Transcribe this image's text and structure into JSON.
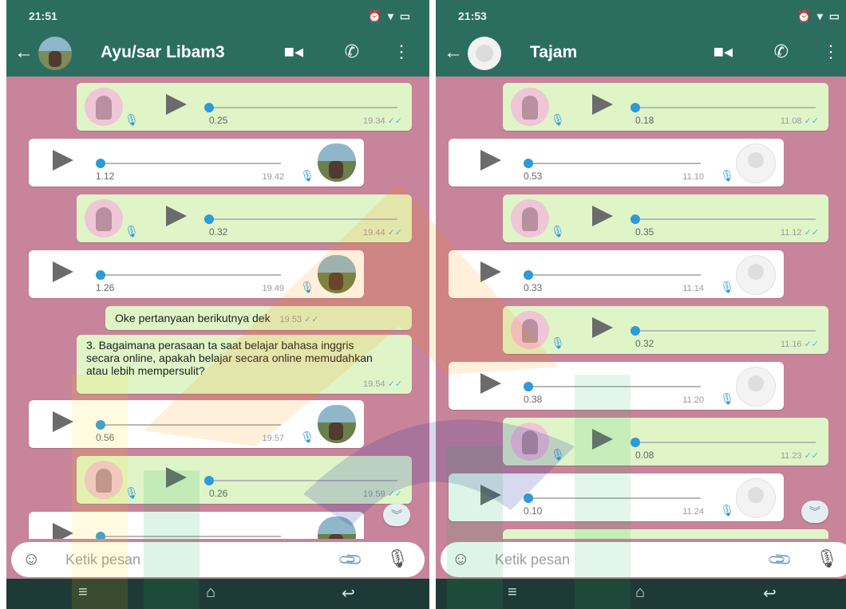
{
  "colors": {
    "header": "#2b6e60",
    "wallpaper": "#c7849a",
    "outgoing": "#dff5c8",
    "incoming": "#ffffff",
    "voice_knob": "#2e9ad8",
    "read_tick": "#4fb5e6"
  },
  "left": {
    "status": {
      "time": "21:51",
      "icons": "⏰ ▾ ▭"
    },
    "contact": "Ayu/sar Libam3",
    "voice": [
      {
        "dir": "out",
        "dur": "0.25",
        "time": "19.34"
      },
      {
        "dir": "in",
        "dur": "1.12",
        "time": "19.42"
      },
      {
        "dir": "out",
        "dur": "0.32",
        "time": "19.44"
      },
      {
        "dir": "in",
        "dur": "1.26",
        "time": "19.49"
      },
      {
        "dir": "in",
        "dur": "0.56",
        "time": "19.57"
      },
      {
        "dir": "out",
        "dur": "0.26",
        "time": "19.59"
      }
    ],
    "text1": {
      "body": "Oke pertanyaan berikutnya dek",
      "time": "19.53"
    },
    "text2": {
      "body": "3.  Bagaimana perasaan ta saat belajar bahasa inggris secara online, apakah belajar secara online memudahkan atau lebih mempersulit?",
      "time": "19.54"
    },
    "placeholder": "Ketik pesan"
  },
  "right": {
    "status": {
      "time": "21:53",
      "icons": "⏰ ▾ ▭"
    },
    "contact": "Tajam",
    "voice": [
      {
        "dir": "out",
        "dur": "0.18",
        "time": "11.08"
      },
      {
        "dir": "in",
        "dur": "0.53",
        "time": "11.10"
      },
      {
        "dir": "out",
        "dur": "0.35",
        "time": "11.12"
      },
      {
        "dir": "in",
        "dur": "0.33",
        "time": "11.14"
      },
      {
        "dir": "out",
        "dur": "0.32",
        "time": "11.16"
      },
      {
        "dir": "in",
        "dur": "0.38",
        "time": "11.20"
      },
      {
        "dir": "out",
        "dur": "0.08",
        "time": "11.23"
      },
      {
        "dir": "in",
        "dur": "0.10",
        "time": "11.24"
      }
    ],
    "placeholder": "Ketik pesan"
  },
  "icons": {
    "back": "back-arrow-icon",
    "video": "video-call-icon",
    "call": "phone-call-icon",
    "menu": "more-menu-icon",
    "emoji": "emoji-icon",
    "attach": "attach-icon",
    "mic": "microphone-icon",
    "read": "double-check-icon"
  }
}
